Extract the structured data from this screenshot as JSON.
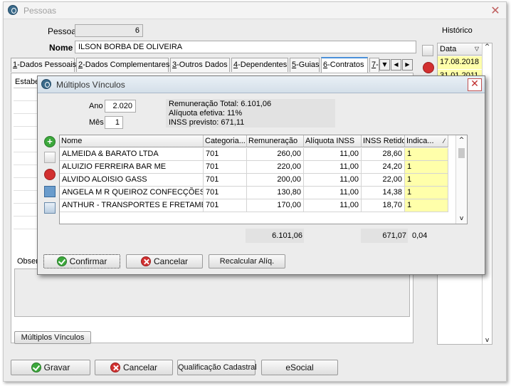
{
  "window": {
    "title": "Pessoas"
  },
  "form": {
    "pessoa_label": "Pessoa",
    "pessoa_value": "6",
    "nome_label": "Nome",
    "nome_value": "ILSON BORBA DE OLIVEIRA"
  },
  "tabs": [
    {
      "key": "1",
      "label": "-Dados Pessoais"
    },
    {
      "key": "2",
      "label": "-Dados Complementares"
    },
    {
      "key": "3",
      "label": "-Outros Dados"
    },
    {
      "key": "4",
      "label": "-Dependentes"
    },
    {
      "key": "5",
      "label": "-Guias"
    },
    {
      "key": "6",
      "label": "-Contratos"
    },
    {
      "key": "7",
      "label": "-"
    }
  ],
  "contracts_partial": {
    "col_header": "Estabe",
    "obs_label": "Obser",
    "multi_button": "Múltiplos Vínculos"
  },
  "historico": {
    "title": "Histórico",
    "col_header": "Data",
    "rows": [
      "17.08.2018",
      "31.01.2011"
    ]
  },
  "dialog": {
    "title": "Múltiplos Vínculos",
    "ano_label": "Ano",
    "ano_value": "2.020",
    "mes_label": "Mês",
    "mes_value": "1",
    "summary": [
      "Remuneração Total: 6.101,06",
      "Alíquota efetiva: 11%",
      "INSS previsto: 671,11"
    ],
    "columns": [
      "Nome",
      "Categoria...",
      "Remuneração",
      "Alíquota INSS",
      "INSS Retido",
      "Indica..."
    ],
    "rows": [
      {
        "nome": "ALMEIDA & BARATO LTDA",
        "categoria": "701",
        "remuneracao": "260,00",
        "aliquota": "11,00",
        "retido": "28,60",
        "indica": "1"
      },
      {
        "nome": "ALUIZIO FERREIRA BAR ME",
        "categoria": "701",
        "remuneracao": "220,00",
        "aliquota": "11,00",
        "retido": "24,20",
        "indica": "1"
      },
      {
        "nome": "ALVIDO ALOISIO GASS",
        "categoria": "701",
        "remuneracao": "200,00",
        "aliquota": "11,00",
        "retido": "22,00",
        "indica": "1"
      },
      {
        "nome": "ANGELA M R QUEIROZ CONFECÇÕES",
        "categoria": "701",
        "remuneracao": "130,80",
        "aliquota": "11,00",
        "retido": "14,38",
        "indica": "1"
      },
      {
        "nome": "ANTHUR - TRANSPORTES E FRETAMENTOS",
        "categoria": "701",
        "remuneracao": "170,00",
        "aliquota": "11,00",
        "retido": "18,70",
        "indica": "1"
      }
    ],
    "totals": {
      "remuneracao": "6.101,06",
      "retido": "671,07",
      "extra": "0,04"
    },
    "buttons": {
      "confirm": "Confirmar",
      "cancel": "Cancelar",
      "recalc": "Recalcular Alíq."
    }
  },
  "bottom_buttons": {
    "save": "Gravar",
    "cancel": "Cancelar",
    "qualificacao": "Qualificação Cadastral",
    "esocial": "eSocial"
  }
}
